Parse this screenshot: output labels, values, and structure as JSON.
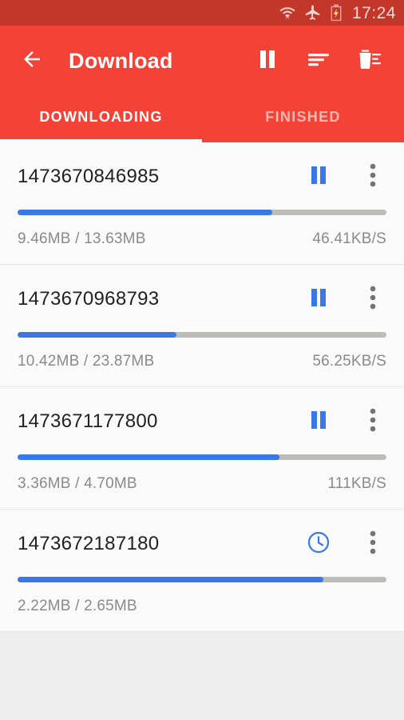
{
  "statusbar": {
    "time": "17:24",
    "icons": [
      "wifi-icon",
      "airplane-mode-icon",
      "battery-charging-icon"
    ],
    "background": "#c3372b"
  },
  "appbar": {
    "background": "#f44336",
    "title": "Download",
    "back_label": "back-arrow",
    "actions": [
      {
        "name": "pause-all-button",
        "icon": "pause-icon"
      },
      {
        "name": "sort-button",
        "icon": "sort-lines-icon"
      },
      {
        "name": "delete-button",
        "icon": "trash-icon"
      }
    ]
  },
  "tabs": {
    "items": [
      {
        "label": "DOWNLOADING",
        "active": true
      },
      {
        "label": "FINISHED",
        "active": false
      }
    ],
    "indicator_color": "#fafafa"
  },
  "downloads": {
    "accent_color": "#3b78e7",
    "track_color": "#bdbdb8",
    "items": [
      {
        "name": "1473670846985",
        "size": "9.46MB / 13.63MB",
        "speed": "46.41KB/S",
        "progress": 69,
        "state_icon": "pause-icon",
        "menu_icon": "overflow-menu-icon"
      },
      {
        "name": "1473670968793",
        "size": "10.42MB / 23.87MB",
        "speed": "56.25KB/S",
        "progress": 43,
        "state_icon": "pause-icon",
        "menu_icon": "overflow-menu-icon"
      },
      {
        "name": "1473671177800",
        "size": "3.36MB / 4.70MB",
        "speed": "111KB/S",
        "progress": 71,
        "state_icon": "pause-icon",
        "menu_icon": "overflow-menu-icon"
      },
      {
        "name": "1473672187180",
        "size": "2.22MB / 2.65MB",
        "speed": "",
        "progress": 83,
        "state_icon": "clock-pending-icon",
        "menu_icon": "overflow-menu-icon"
      }
    ]
  }
}
